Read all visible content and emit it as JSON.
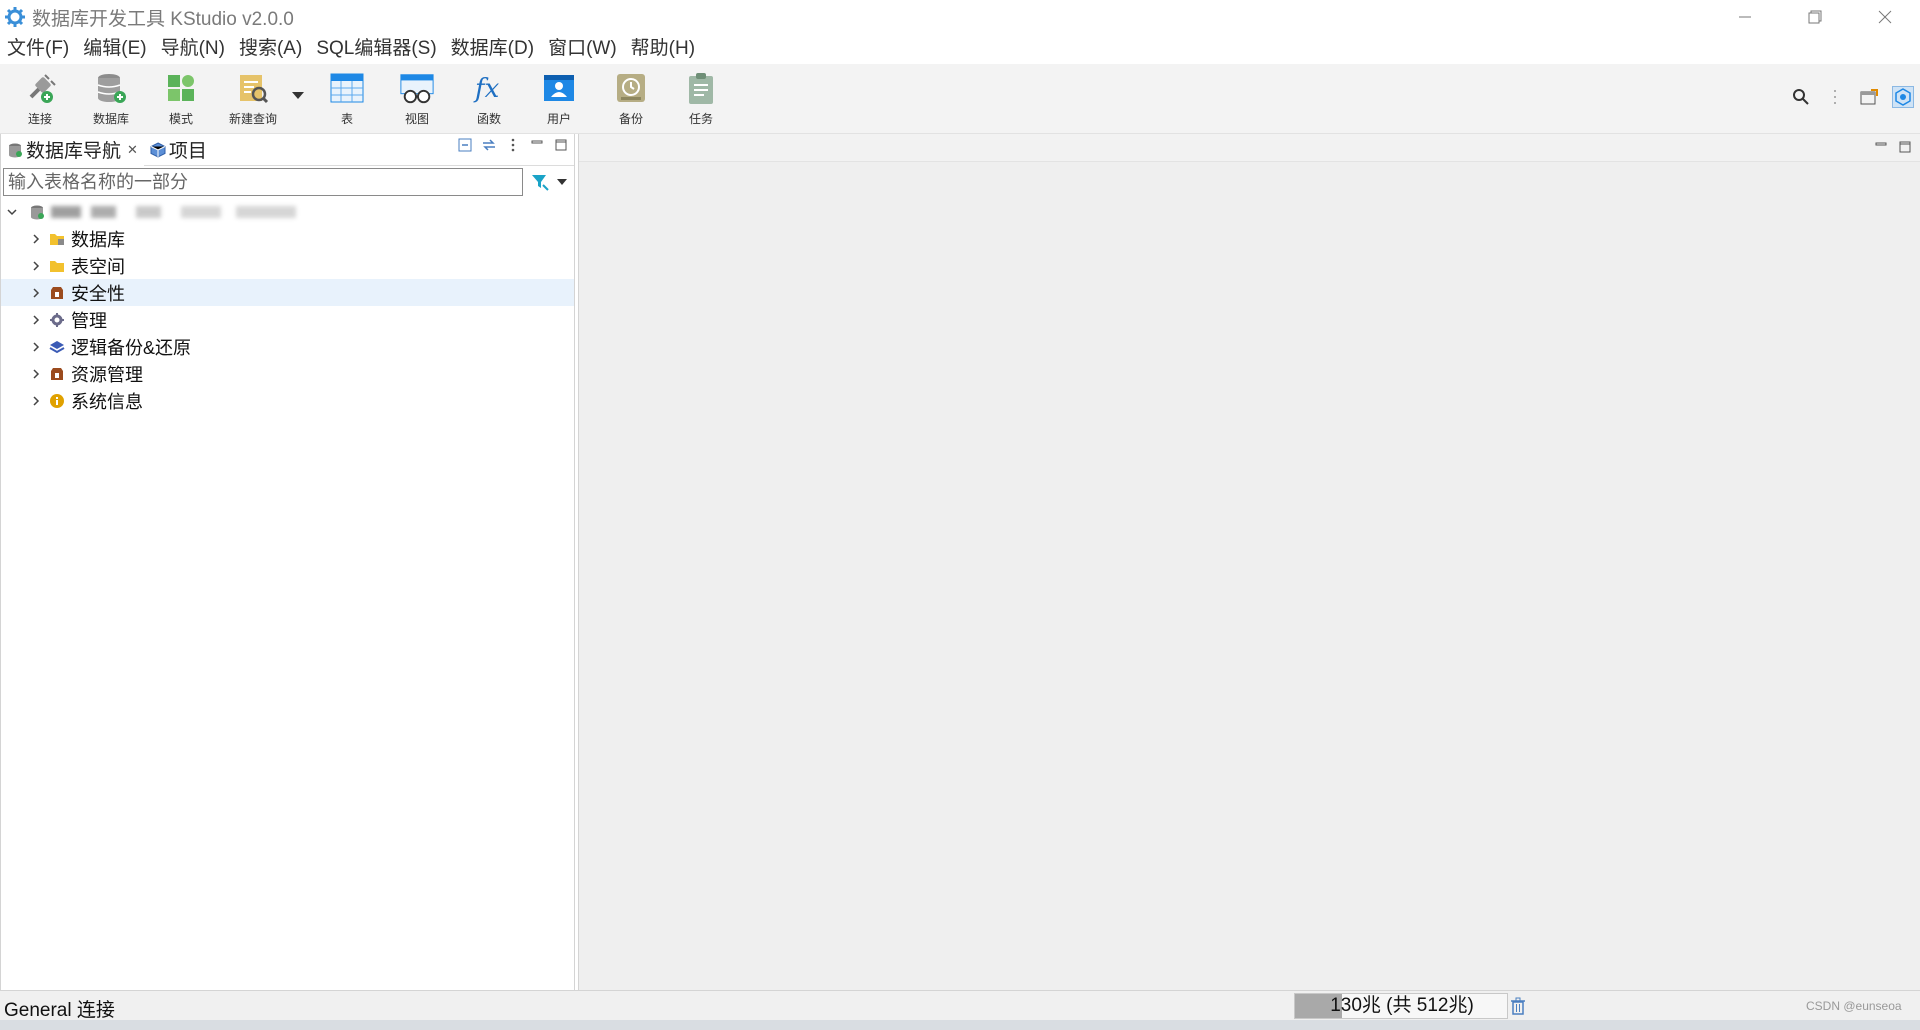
{
  "window": {
    "title": "数据库开发工具 KStudio v2.0.0",
    "controls": [
      "minimize",
      "restore",
      "close"
    ]
  },
  "menu": {
    "items": [
      "文件(F)",
      "编辑(E)",
      "导航(N)",
      "搜索(A)",
      "SQL编辑器(S)",
      "数据库(D)",
      "窗口(W)",
      "帮助(H)"
    ]
  },
  "toolbar": {
    "buttons": [
      {
        "label": "连接",
        "icon": "plug-connect-icon"
      },
      {
        "label": "数据库",
        "icon": "database-add-icon"
      },
      {
        "label": "模式",
        "icon": "schema-icon"
      },
      {
        "label": "新建查询",
        "icon": "new-query-icon"
      },
      {
        "label": "表",
        "icon": "table-icon"
      },
      {
        "label": "视图",
        "icon": "view-icon"
      },
      {
        "label": "函数",
        "icon": "function-icon"
      },
      {
        "label": "用户",
        "icon": "user-icon"
      },
      {
        "label": "备份",
        "icon": "backup-icon"
      },
      {
        "label": "任务",
        "icon": "task-icon"
      }
    ]
  },
  "navigator": {
    "tabs": [
      {
        "label": "数据库导航",
        "icon": "database-nav-icon",
        "active": true
      },
      {
        "label": "项目",
        "icon": "project-icon",
        "active": false
      }
    ],
    "filter": {
      "placeholder": "输入表格名称的一部分",
      "value": ""
    },
    "tree": {
      "root_label_visible": false,
      "children": [
        {
          "label": "数据库",
          "icon": "folder-database-icon",
          "selected": false
        },
        {
          "label": "表空间",
          "icon": "folder-icon",
          "selected": false
        },
        {
          "label": "安全性",
          "icon": "security-icon",
          "selected": true
        },
        {
          "label": "管理",
          "icon": "gear-icon",
          "selected": false
        },
        {
          "label": "逻辑备份&还原",
          "icon": "layers-icon",
          "selected": false
        },
        {
          "label": "资源管理",
          "icon": "resource-icon",
          "selected": false
        },
        {
          "label": "系统信息",
          "icon": "info-icon",
          "selected": false
        }
      ]
    }
  },
  "status": {
    "text": "General 连接",
    "memory": "130兆 (共 512兆)",
    "memory_used_fraction": 0.22,
    "watermark": "CSDN @eunseoa"
  },
  "colors": {
    "accent_blue": "#1e88e5",
    "selected_row": "#e8f2fc",
    "toolbar_bg": "#f3f3f3",
    "editor_bg": "#efefef"
  }
}
